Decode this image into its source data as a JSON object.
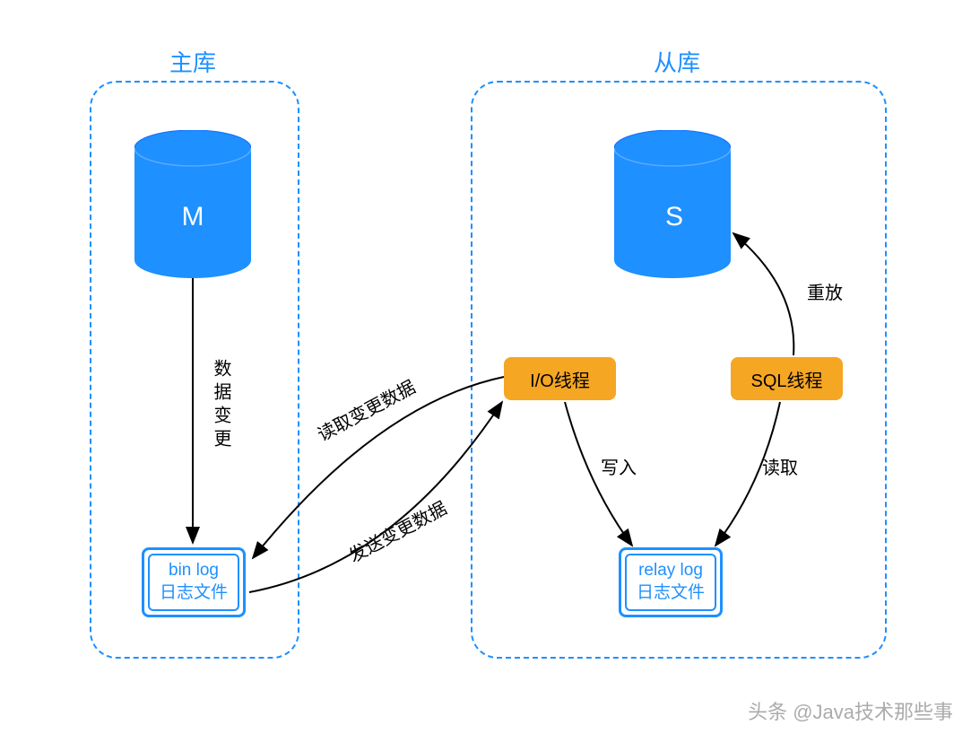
{
  "master": {
    "title": "主库",
    "db_label": "M",
    "log_title": "bin log",
    "log_subtitle": "日志文件",
    "change_label": "数据变更"
  },
  "slave": {
    "title": "从库",
    "db_label": "S",
    "log_title": "relay log",
    "log_subtitle": "日志文件",
    "io_thread": "I/O线程",
    "sql_thread": "SQL线程",
    "write_label": "写入",
    "read_label": "读取",
    "replay_label": "重放"
  },
  "connections": {
    "read_change": "读取变更数据",
    "send_change": "发送变更数据"
  },
  "watermark": "头条 @Java技术那些事",
  "colors": {
    "blue": "#1e90ff",
    "orange": "#f5a623"
  }
}
